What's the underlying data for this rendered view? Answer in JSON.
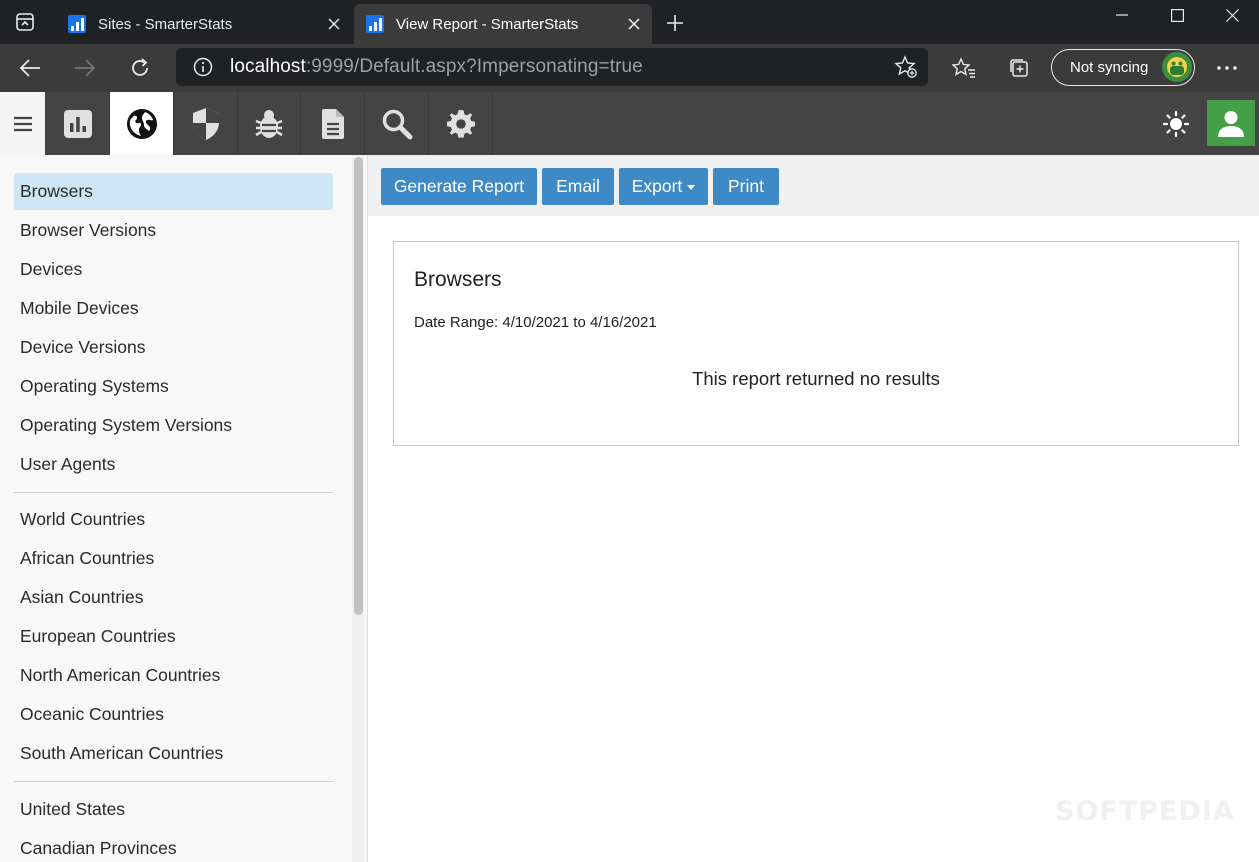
{
  "browser": {
    "tabs": [
      {
        "title": "Sites - SmarterStats",
        "active": false
      },
      {
        "title": "View Report - SmarterStats",
        "active": true
      }
    ],
    "url_host": "localhost",
    "url_rest": ":9999/Default.aspx?Impersonating=true",
    "sync_label": "Not syncing"
  },
  "toolbar": {
    "icons": [
      "chart-icon",
      "globe-icon",
      "shield-icon",
      "bug-icon",
      "document-icon",
      "search-icon",
      "gear-icon"
    ],
    "active": "globe-icon"
  },
  "sidebar": {
    "groups": [
      [
        "Browsers",
        "Browser Versions",
        "Devices",
        "Mobile Devices",
        "Device Versions",
        "Operating Systems",
        "Operating System Versions",
        "User Agents"
      ],
      [
        "World Countries",
        "African Countries",
        "Asian Countries",
        "European Countries",
        "North American Countries",
        "Oceanic Countries",
        "South American Countries"
      ],
      [
        "United States",
        "Canadian Provinces"
      ]
    ],
    "selected": "Browsers"
  },
  "actions": {
    "generate": "Generate Report",
    "email": "Email",
    "export": "Export",
    "print": "Print"
  },
  "report": {
    "title": "Browsers",
    "date_range": "Date Range: 4/10/2021 to 4/16/2021",
    "empty_message": "This report returned no results"
  },
  "watermark": "SOFTPEDIA",
  "colors": {
    "accent": "#3d8ac7",
    "selected_item": "#cde6f5",
    "user_button": "#43a047",
    "toolbar": "#444444"
  }
}
